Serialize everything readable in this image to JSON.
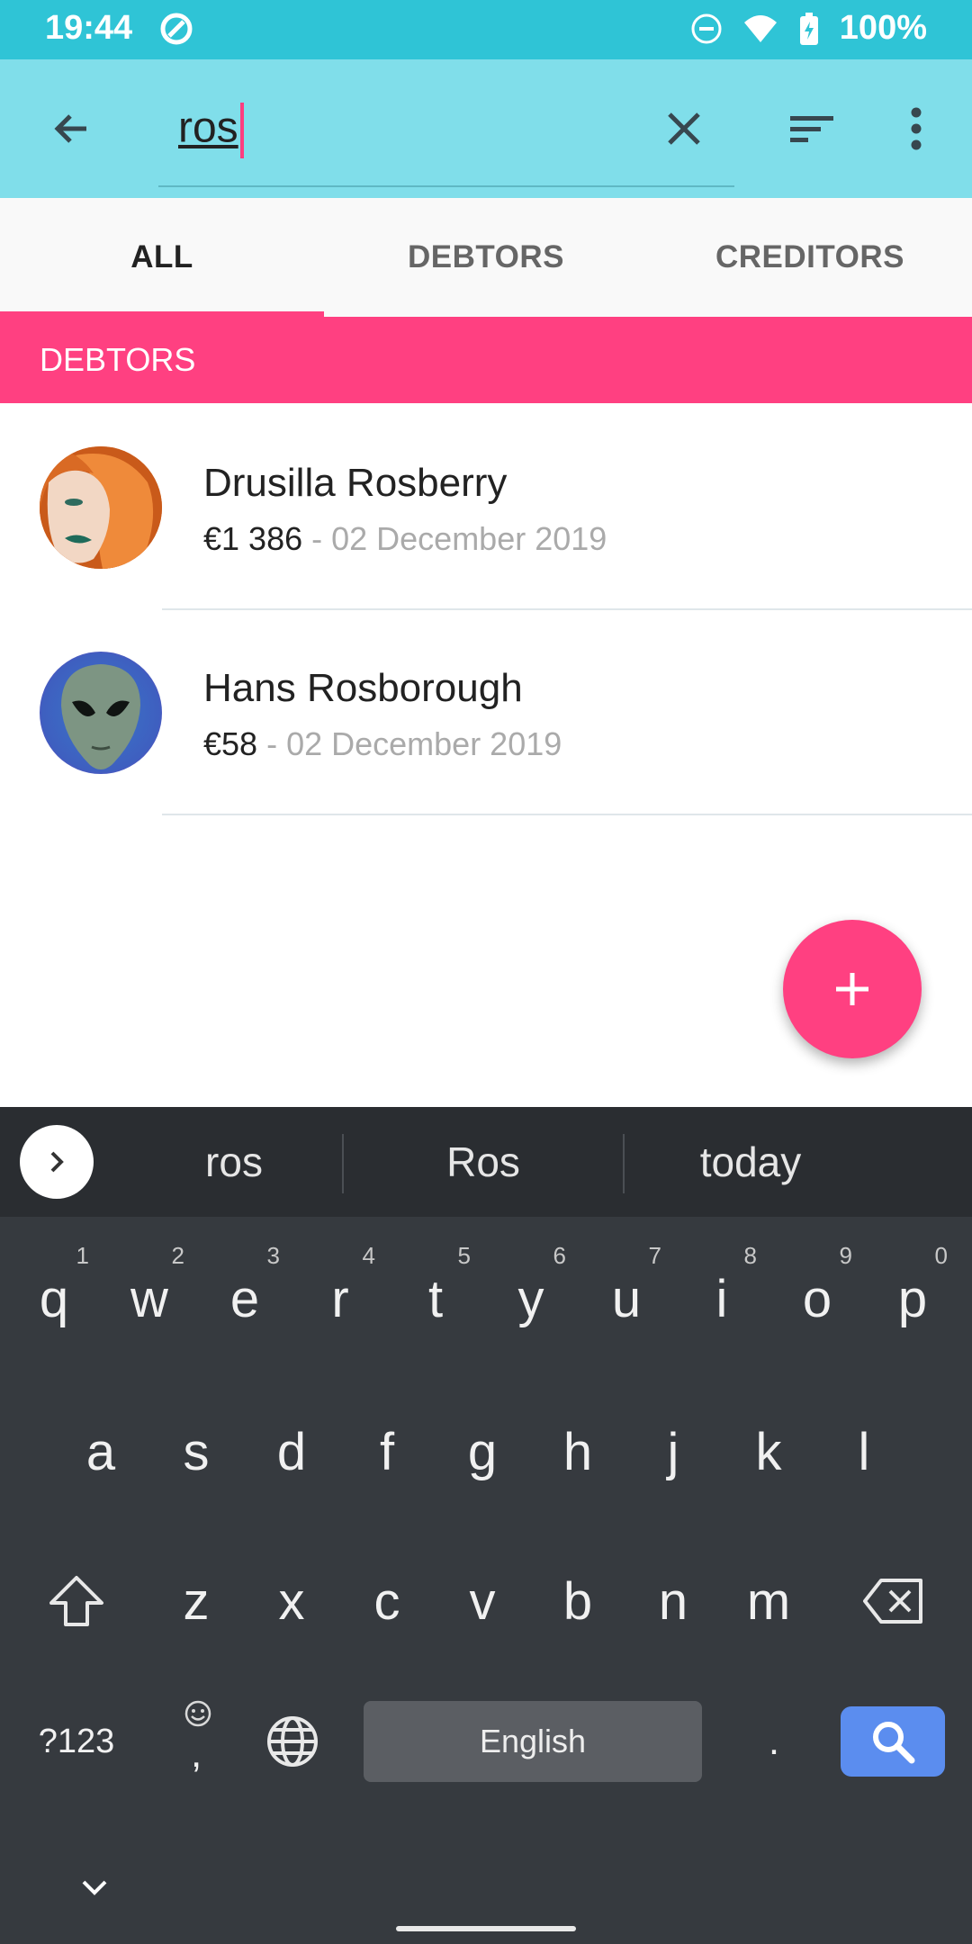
{
  "status_bar": {
    "time": "19:44",
    "battery": "100%"
  },
  "search": {
    "query": "ros"
  },
  "tabs": [
    {
      "label": "ALL",
      "active": true
    },
    {
      "label": "DEBTORS",
      "active": false
    },
    {
      "label": "CREDITORS",
      "active": false
    }
  ],
  "section": {
    "title": "DEBTORS"
  },
  "contacts": [
    {
      "name": "Drusilla Rosberry",
      "amount": "€1 386",
      "date": " - 02 December 2019"
    },
    {
      "name": "Hans Rosborough",
      "amount": "€58",
      "date": " - 02 December 2019"
    }
  ],
  "fab": {
    "label": "+"
  },
  "keyboard": {
    "suggestions": [
      "ros",
      "Ros",
      "today"
    ],
    "row1": [
      "q",
      "w",
      "e",
      "r",
      "t",
      "y",
      "u",
      "i",
      "o",
      "p"
    ],
    "row1_hints": [
      "1",
      "2",
      "3",
      "4",
      "5",
      "6",
      "7",
      "8",
      "9",
      "0"
    ],
    "row2": [
      "a",
      "s",
      "d",
      "f",
      "g",
      "h",
      "j",
      "k",
      "l"
    ],
    "row3": [
      "z",
      "x",
      "c",
      "v",
      "b",
      "n",
      "m"
    ],
    "symbols_key": "?123",
    "comma": ",",
    "period": ".",
    "space_label": "English"
  },
  "colors": {
    "status_bar": "#2fc4d6",
    "app_bar": "#80deea",
    "accent": "#ff4081",
    "keyboard_bg": "#363a3f",
    "search_key": "#5b8def"
  }
}
